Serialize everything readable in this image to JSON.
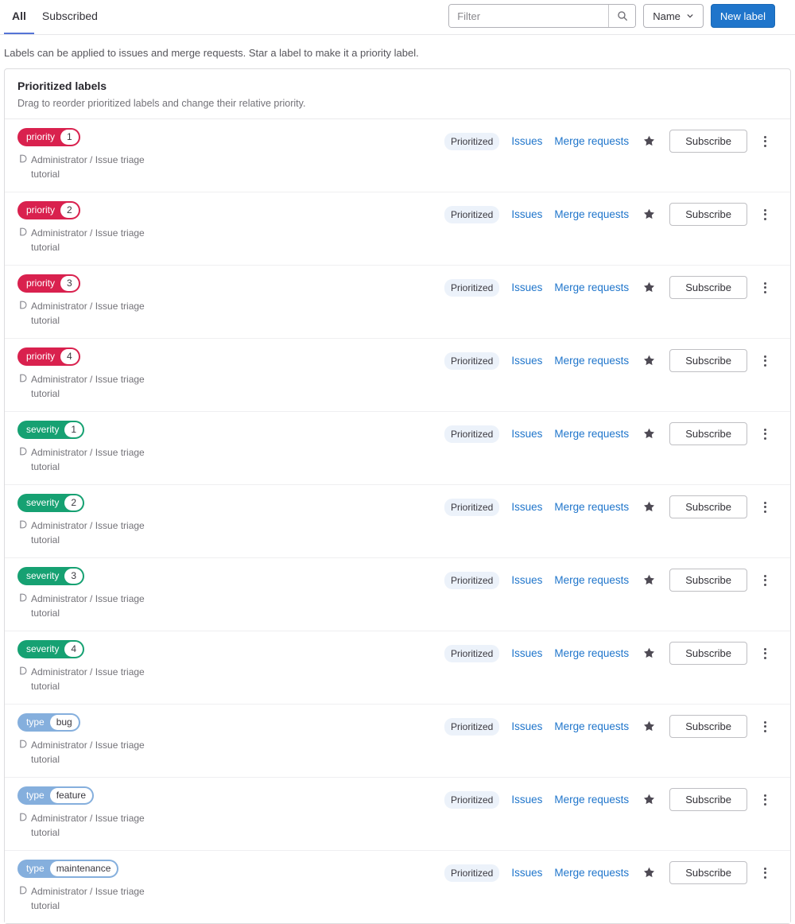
{
  "tabs": {
    "all": "All",
    "subscribed": "Subscribed"
  },
  "toolbar": {
    "filter_placeholder": "Filter",
    "sort_button": "Name",
    "new_label_button": "New label"
  },
  "description": "Labels can be applied to issues and merge requests. Star a label to make it a priority label.",
  "prioritized_panel": {
    "title": "Prioritized labels",
    "subtitle": "Drag to reorder prioritized labels and change their relative priority."
  },
  "row_common": {
    "project_path": "Administrator / Issue triage tutorial",
    "prioritized_badge": "Prioritized",
    "issues_link": "Issues",
    "merge_requests_link": "Merge requests",
    "subscribe_button": "Subscribe"
  },
  "labels": [
    {
      "scope": "priority",
      "value": "1",
      "color": "#d9214e"
    },
    {
      "scope": "priority",
      "value": "2",
      "color": "#d9214e"
    },
    {
      "scope": "priority",
      "value": "3",
      "color": "#d9214e"
    },
    {
      "scope": "priority",
      "value": "4",
      "color": "#d9214e"
    },
    {
      "scope": "severity",
      "value": "1",
      "color": "#16a172"
    },
    {
      "scope": "severity",
      "value": "2",
      "color": "#16a172"
    },
    {
      "scope": "severity",
      "value": "3",
      "color": "#16a172"
    },
    {
      "scope": "severity",
      "value": "4",
      "color": "#16a172"
    },
    {
      "scope": "type",
      "value": "bug",
      "color": "#85afdd"
    },
    {
      "scope": "type",
      "value": "feature",
      "color": "#85afdd"
    },
    {
      "scope": "type",
      "value": "maintenance",
      "color": "#85afdd"
    }
  ],
  "colors": {
    "accent_blue": "#1f75cb",
    "tab_indicator": "#5574d6",
    "priority_red": "#d9214e",
    "severity_green": "#16a172",
    "type_blue": "#85afdd",
    "prioritized_badge_bg": "#ecf2fa"
  }
}
